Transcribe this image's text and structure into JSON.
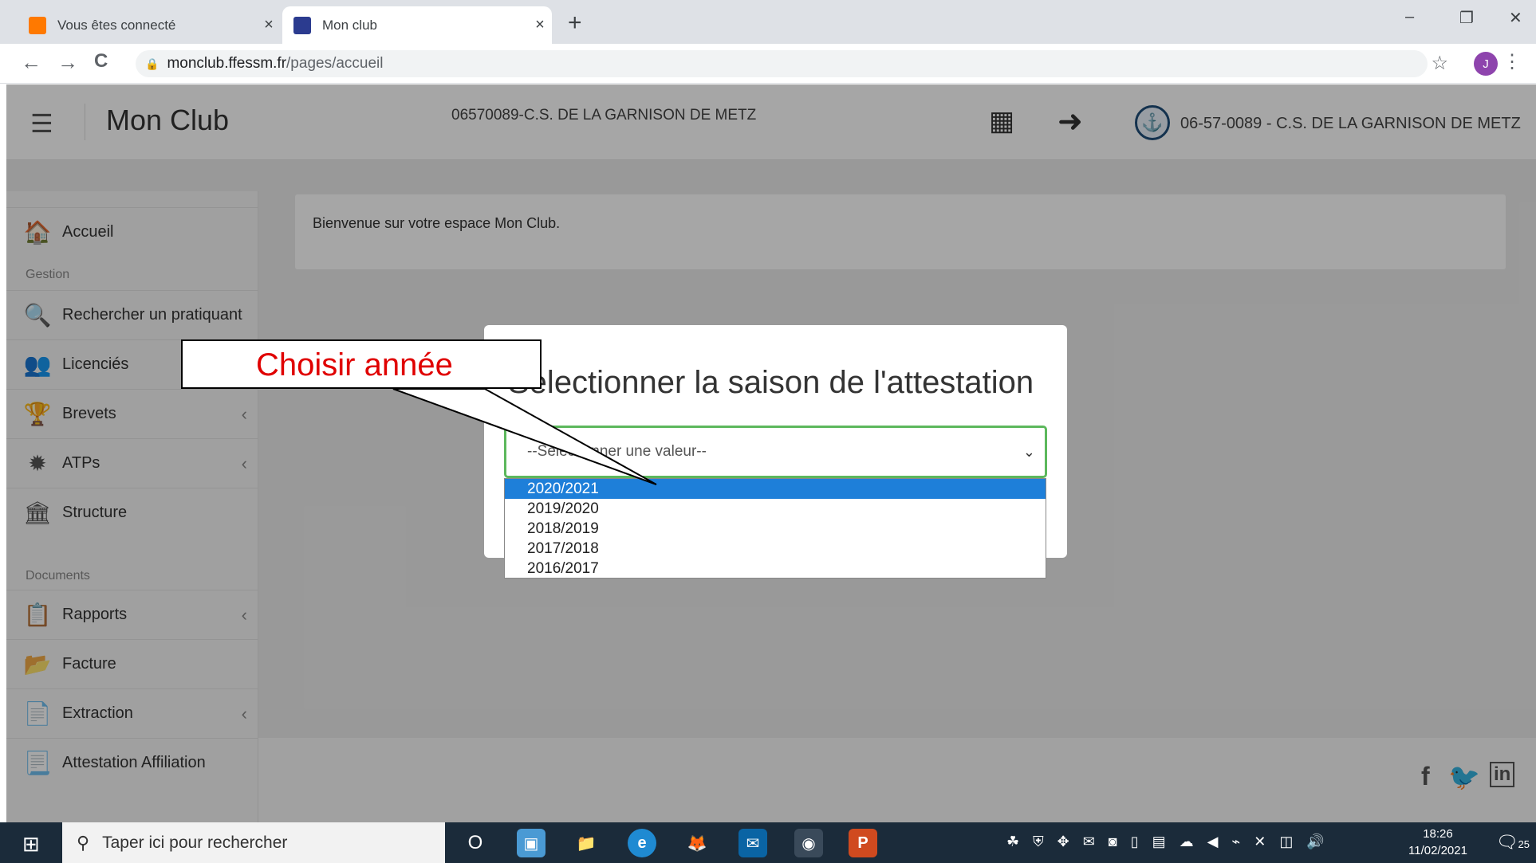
{
  "browser": {
    "tabs": [
      {
        "title": "Vous êtes connecté",
        "active": false
      },
      {
        "title": "Mon club",
        "active": true
      }
    ],
    "url_host": "monclub.ffessm.fr",
    "url_path": "/pages/accueil",
    "profile_initial": "J",
    "icons": {
      "close": "×",
      "newtab": "+",
      "minimize": "–",
      "restore": "❐",
      "winclose": "✕",
      "back": "←",
      "forward": "→",
      "reload": "C",
      "lock": "🔒",
      "star": "☆",
      "menu": "⋮"
    }
  },
  "header": {
    "brand": "Mon Club",
    "club_code_center": "06570089-C.S. DE LA GARNISON DE METZ",
    "club_right": "06-57-0089 - C.S. DE LA GARNISON DE METZ",
    "icons": {
      "hamburger": "☰",
      "apps": "▦",
      "logout": "➜",
      "logo": "⚓"
    }
  },
  "sidebar": {
    "items": [
      {
        "label": "Accueil",
        "icon": "🏠"
      },
      {
        "label": "Rechercher un pratiquant",
        "icon": "🔍"
      },
      {
        "label": "Licenciés",
        "icon": "👥",
        "chev": "‹"
      },
      {
        "label": "Brevets",
        "icon": "🏆",
        "chev": "‹"
      },
      {
        "label": "ATPs",
        "icon": "✹",
        "chev": "‹"
      },
      {
        "label": "Structure",
        "icon": "🏛"
      },
      {
        "label": "Rapports",
        "icon": "📋",
        "chev": "‹"
      },
      {
        "label": "Facture",
        "icon": "📂"
      },
      {
        "label": "Extraction",
        "icon": "📄",
        "chev": "‹"
      },
      {
        "label": "Attestation Affiliation",
        "icon": "📃"
      }
    ],
    "sections": {
      "gestion": "Gestion",
      "documents": "Documents"
    }
  },
  "main": {
    "welcome": "Bienvenue sur votre espace Mon Club."
  },
  "modal": {
    "title": "Selectionner la saison de l'attestation",
    "select_placeholder": "--Selectionner une valeur--",
    "caret": "⌄",
    "options": [
      "2020/2021",
      "2019/2020",
      "2018/2019",
      "2017/2018",
      "2016/2017"
    ],
    "selected_index": 0
  },
  "annotation": {
    "text": "Choisir année"
  },
  "footer": {
    "social": [
      "f",
      "🐦",
      "in"
    ]
  },
  "taskbar": {
    "start_icon": "⊞",
    "search_icon": "⚲",
    "search_placeholder": "Taper ici pour rechercher",
    "apps": [
      "O",
      "▣",
      "📁",
      "e",
      "🦊",
      "✉",
      "◉",
      "P"
    ],
    "tray": "☘ ⛨ ✥ ✉ ◙ ▯ ▤ ☁ ◀ ⌁ ✕ ◫ 🔊",
    "time": "18:26",
    "date": "11/02/2021",
    "notifications": "25",
    "notif_icon": "🗨"
  }
}
